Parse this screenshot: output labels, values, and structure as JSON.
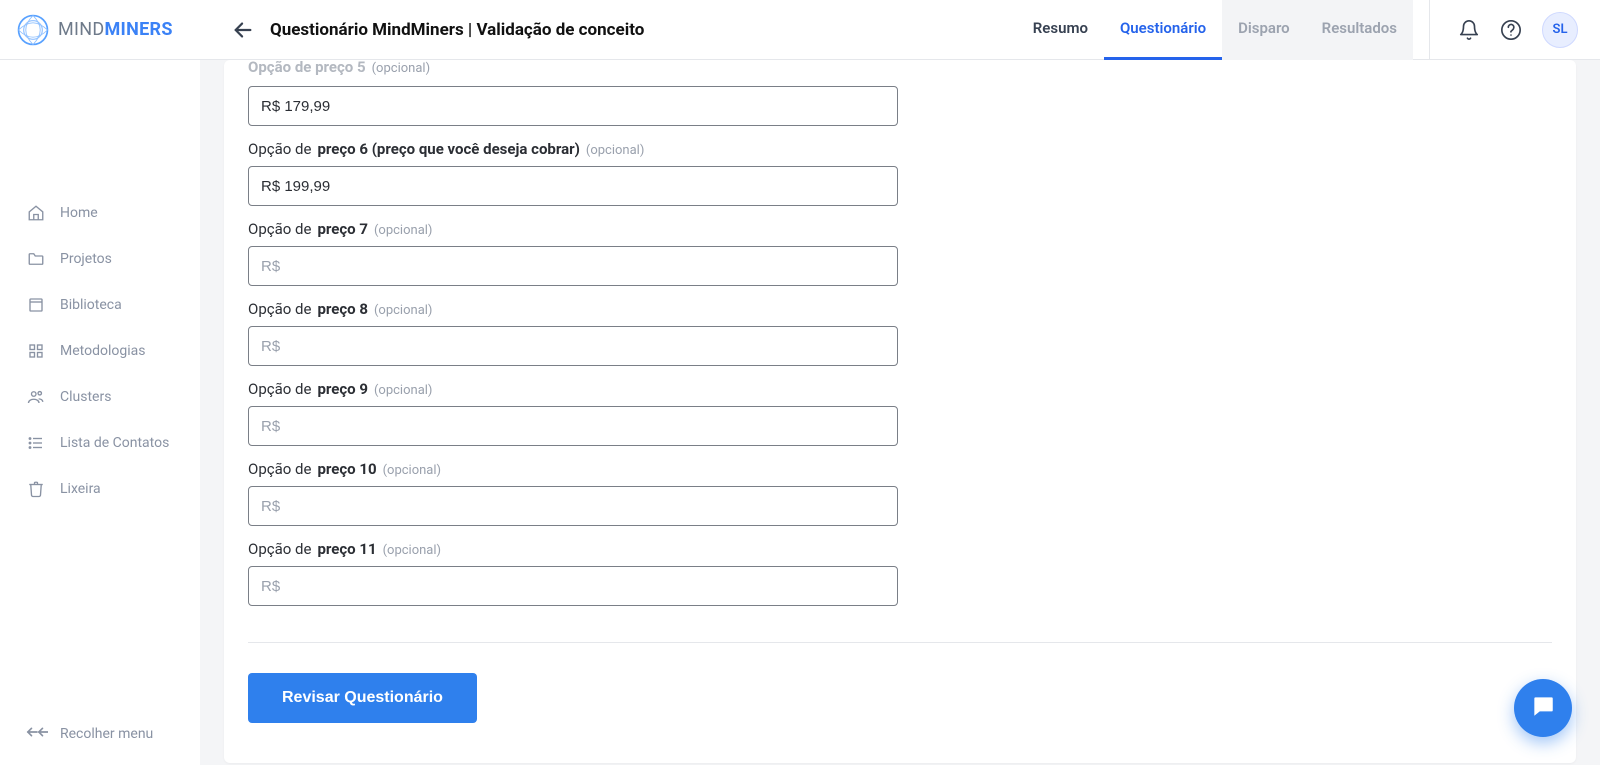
{
  "brand": {
    "name_part1": "MIND",
    "name_part2": "MINERS"
  },
  "header": {
    "title": "Questionário MindMiners | Validação de conceito",
    "tabs": [
      {
        "label": "Resumo",
        "state": "default"
      },
      {
        "label": "Questionário",
        "state": "active"
      },
      {
        "label": "Disparo",
        "state": "disabled"
      },
      {
        "label": "Resultados",
        "state": "disabled"
      }
    ],
    "avatar_initials": "SL"
  },
  "sidebar": {
    "items": [
      {
        "icon": "home",
        "label": "Home"
      },
      {
        "icon": "folder",
        "label": "Projetos"
      },
      {
        "icon": "book",
        "label": "Biblioteca"
      },
      {
        "icon": "grid",
        "label": "Metodologias"
      },
      {
        "icon": "users",
        "label": "Clusters"
      },
      {
        "icon": "list",
        "label": "Lista de Contatos"
      },
      {
        "icon": "trash",
        "label": "Lixeira"
      }
    ],
    "collapse_label": "Recolher menu"
  },
  "form": {
    "option_prefix": "Opção de",
    "optional_text": "(opcional)",
    "placeholder": "R$",
    "truncated_label": {
      "bold": "Opção de preço 5",
      "value": "R$ 179,99"
    },
    "fields": [
      {
        "bold": "preço 6 (preço que você deseja cobrar)",
        "value": "R$ 199,99"
      },
      {
        "bold": "preço 7",
        "value": ""
      },
      {
        "bold": "preço 8",
        "value": ""
      },
      {
        "bold": "preço 9",
        "value": ""
      },
      {
        "bold": "preço 10",
        "value": ""
      },
      {
        "bold": "preço 11",
        "value": ""
      }
    ],
    "submit_label": "Revisar Questionário"
  }
}
